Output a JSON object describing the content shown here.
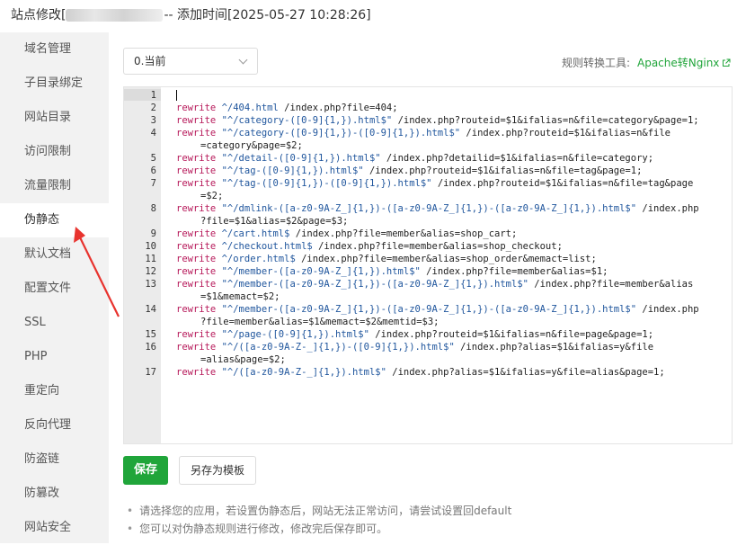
{
  "window": {
    "title_prefix": "站点修改[",
    "title_suffix": "-- 添加时间[2025-05-27 10:28:26]"
  },
  "sidebar": {
    "items": [
      {
        "label": "域名管理"
      },
      {
        "label": "子目录绑定"
      },
      {
        "label": "网站目录"
      },
      {
        "label": "访问限制"
      },
      {
        "label": "流量限制"
      },
      {
        "label": "伪静态"
      },
      {
        "label": "默认文档"
      },
      {
        "label": "配置文件"
      },
      {
        "label": "SSL"
      },
      {
        "label": "PHP"
      },
      {
        "label": "重定向"
      },
      {
        "label": "反向代理"
      },
      {
        "label": "防盗链"
      },
      {
        "label": "防篡改"
      },
      {
        "label": "网站安全"
      }
    ],
    "active_index": 5
  },
  "toolbar": {
    "select_value": "0.当前",
    "tool_label": "规则转换工具:",
    "tool_link": "Apache转Nginx"
  },
  "editor": {
    "lines": [
      {
        "n": "1",
        "kw": "",
        "s1": "",
        "r": "",
        "s2": "",
        "rest": "",
        "wrap": ""
      },
      {
        "n": "2",
        "kw": "rewrite",
        "s1": "^/404.html",
        "rest": " /index.php?file=404;",
        "wrap": ""
      },
      {
        "n": "3",
        "kw": "rewrite",
        "s1": "\"^/category-([0-9]{1,}).html$\"",
        "rest": " /index.php?routeid=$1&ifalias=n&file=category&page=1;",
        "wrap": ""
      },
      {
        "n": "4",
        "kw": "rewrite",
        "s1": "\"^/category-([0-9]{1,})-([0-9]{1,}).html$\"",
        "rest": " /index.php?routeid=$1&ifalias=n&file",
        "wrap": "=category&page=$2;"
      },
      {
        "n": "5",
        "kw": "rewrite",
        "s1": "\"^/detail-([0-9]{1,}).html$\"",
        "rest": " /index.php?detailid=$1&ifalias=n&file=category;",
        "wrap": ""
      },
      {
        "n": "6",
        "kw": "rewrite",
        "s1": "\"^/tag-([0-9]{1,}).html$\"",
        "rest": " /index.php?routeid=$1&ifalias=n&file=tag&page=1;",
        "wrap": ""
      },
      {
        "n": "7",
        "kw": "rewrite",
        "s1": "\"^/tag-([0-9]{1,})-([0-9]{1,}).html$\"",
        "rest": " /index.php?routeid=$1&ifalias=n&file=tag&page",
        "wrap": "=$2;"
      },
      {
        "n": "8",
        "kw": "rewrite",
        "s1": "\"^/dmlink-([a-z0-9A-Z_]{1,})-([a-z0-9A-Z_]{1,})-([a-z0-9A-Z_]{1,}).html$\"",
        "rest": " /index.php",
        "wrap": "?file=$1&alias=$2&page=$3;"
      },
      {
        "n": "9",
        "kw": "rewrite",
        "s1": "^/cart.html$",
        "rest": " /index.php?file=member&alias=shop_cart;",
        "wrap": ""
      },
      {
        "n": "10",
        "kw": "rewrite",
        "s1": "^/checkout.html$",
        "rest": " /index.php?file=member&alias=shop_checkout;",
        "wrap": ""
      },
      {
        "n": "11",
        "kw": "rewrite",
        "s1": "^/order.html$",
        "rest": " /index.php?file=member&alias=shop_order&memact=list;",
        "wrap": ""
      },
      {
        "n": "12",
        "kw": "rewrite",
        "s1": "\"^/member-([a-z0-9A-Z_]{1,}).html$\"",
        "rest": " /index.php?file=member&alias=$1;",
        "wrap": ""
      },
      {
        "n": "13",
        "kw": "rewrite",
        "s1": "\"^/member-([a-z0-9A-Z_]{1,})-([a-z0-9A-Z_]{1,}).html$\"",
        "rest": " /index.php?file=member&alias",
        "wrap": "=$1&memact=$2;"
      },
      {
        "n": "14",
        "kw": "rewrite",
        "s1": "\"^/member-([a-z0-9A-Z_]{1,})-([a-z0-9A-Z_]{1,})-([a-z0-9A-Z_]{1,}).html$\"",
        "rest": " /index.php",
        "wrap": "?file=member&alias=$1&memact=$2&memtid=$3;"
      },
      {
        "n": "15",
        "kw": "rewrite",
        "s1": "\"^/page-([0-9]{1,}).html$\"",
        "rest": " /index.php?routeid=$1&ifalias=n&file=page&page=1;",
        "wrap": ""
      },
      {
        "n": "16",
        "kw": "rewrite",
        "s1": "\"^/([a-z0-9A-Z-_]{1,})-([0-9]{1,}).html$\"",
        "rest": " /index.php?alias=$1&ifalias=y&file",
        "wrap": "=alias&page=$2;"
      },
      {
        "n": "17",
        "kw": "rewrite",
        "s1": "\"^/([a-z0-9A-Z-_]{1,}).html$\"",
        "rest": " /index.php?alias=$1&ifalias=y&file=alias&page=1;",
        "wrap": ""
      }
    ]
  },
  "actions": {
    "save_label": "保存",
    "save_template_label": "另存为模板"
  },
  "tips": [
    "请选择您的应用，若设置伪静态后，网站无法正常访问，请尝试设置回default",
    "您可以对伪静态规则进行修改，修改完后保存即可。"
  ],
  "colors": {
    "accent": "#20a53a",
    "keyword": "#b7195a",
    "string": "#20569d",
    "annotation_arrow": "#e8332e"
  }
}
